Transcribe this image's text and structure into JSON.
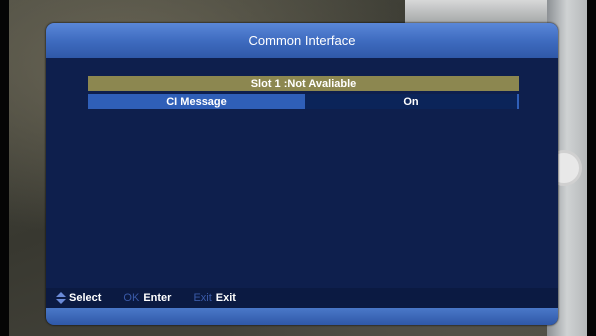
{
  "dialog": {
    "title": "Common Interface"
  },
  "slot": {
    "status_text": "Slot 1 :Not Avaliable"
  },
  "ci_message": {
    "label": "CI Message",
    "value": "On"
  },
  "footer": {
    "select_label": "Select",
    "ok_key": "OK",
    "ok_label": "Enter",
    "exit_key": "Exit",
    "exit_label": "Exit"
  },
  "icons": {
    "select": "up-down-arrow-icon"
  },
  "colors": {
    "header_blue": "#3f6cc0",
    "body_navy": "#0e1f4d",
    "slot_row_olive": "#8c8750",
    "selected_row_blue": "#2f5fb8"
  }
}
